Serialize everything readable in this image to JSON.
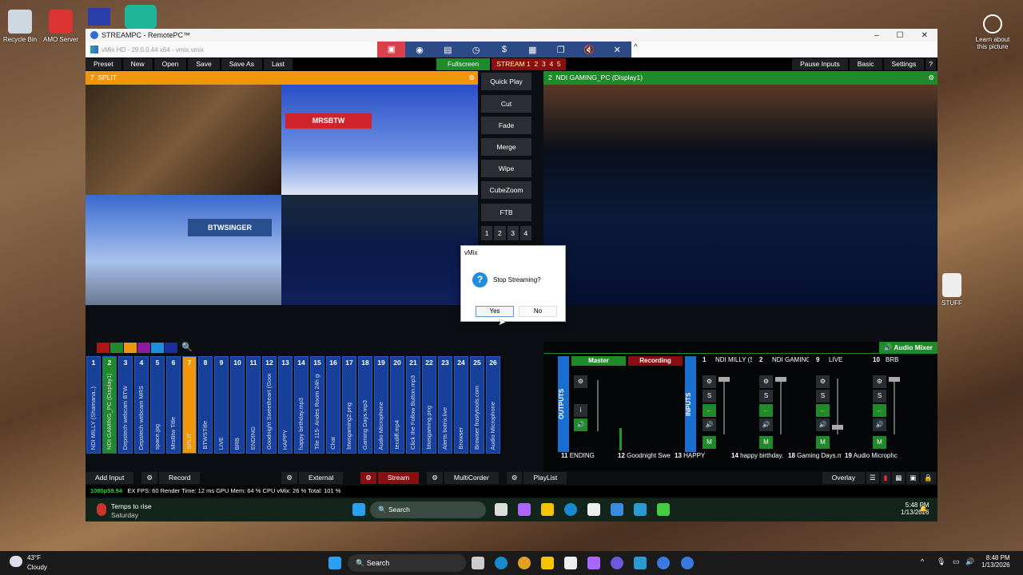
{
  "desktop": {
    "icons": [
      "Recycle Bin",
      "AMO Server"
    ],
    "learn": "Learn about this picture",
    "stuff": "STUFF"
  },
  "remote_window": {
    "title": "STREAMPC - RemotePC™"
  },
  "vmix": {
    "title": "vMix HD - 29.0.0.44 x64 - vmix.vmix",
    "toolbar": {
      "preset": "Preset",
      "new": "New",
      "open": "Open",
      "save": "Save",
      "save_as": "Save As",
      "last": "Last",
      "fullscreen": "Fullscreen",
      "stream": "STREAM",
      "stream_nums": [
        "1",
        "2",
        "3",
        "4",
        "5"
      ],
      "pause_inputs": "Pause Inputs",
      "basic": "Basic",
      "settings": "Settings",
      "help": "?"
    },
    "preview": {
      "number": "7",
      "name": "SPLIT",
      "overlay_labels": [
        "MRSBTW",
        "BTWSINGER"
      ]
    },
    "program": {
      "number": "2",
      "name": "NDI GAMING_PC (Display1)"
    },
    "transitions": [
      "Quick Play",
      "Cut",
      "Fade",
      "Merge",
      "Wipe",
      "CubeZoom",
      "FTB"
    ],
    "transition_nums": [
      "1",
      "2",
      "3",
      "4"
    ],
    "color_tags": [
      "#b01515",
      "#1e8a2a",
      "#f0960a",
      "#8a1aa0",
      "#1a8ee0",
      "#1a2ea0"
    ],
    "inputs": [
      {
        "n": "1",
        "label": "NDI MILLY (Shamana..)"
      },
      {
        "n": "2",
        "label": "NDI GAMING_PC (Display1)",
        "state": "program"
      },
      {
        "n": "3",
        "label": "Depstech webcam BTW"
      },
      {
        "n": "4",
        "label": "Depstech webcam MRS"
      },
      {
        "n": "5",
        "label": "space.jpg"
      },
      {
        "n": "6",
        "label": "MrsBtw Title"
      },
      {
        "n": "7",
        "label": "SPLIT",
        "state": "preview"
      },
      {
        "n": "8",
        "label": "BTWSTitle"
      },
      {
        "n": "9",
        "label": "LIVE"
      },
      {
        "n": "10",
        "label": "BRB"
      },
      {
        "n": "11",
        "label": "ENDING"
      },
      {
        "n": "12",
        "label": "Goodnight Sweetheart (Goodnite"
      },
      {
        "n": "13",
        "label": "HAPPY"
      },
      {
        "n": "14",
        "label": "happy birthday.mp3"
      },
      {
        "n": "15",
        "label": "Tile 115- Andes Room 24h gif"
      },
      {
        "n": "16",
        "label": "Chat"
      },
      {
        "n": "17",
        "label": "btwsgaming2.png"
      },
      {
        "n": "18",
        "label": "Gaming Days.mp3"
      },
      {
        "n": "19",
        "label": "Audio Microphone"
      },
      {
        "n": "20",
        "label": "tecdiff.mp4"
      },
      {
        "n": "21",
        "label": "Click the Follow Button.mp3"
      },
      {
        "n": "22",
        "label": "btwsgaming.png"
      },
      {
        "n": "23",
        "label": "Alerts botrix.live"
      },
      {
        "n": "24",
        "label": "Browser"
      },
      {
        "n": "25",
        "label": "Browser frostytools.com"
      },
      {
        "n": "26",
        "label": "Audio Microphone"
      }
    ],
    "audio_mixer": {
      "title": "Audio Mixer",
      "outputs": "OUTPUTS",
      "inputs_label": "INPUTS",
      "master": "Master",
      "recording": "Recording",
      "channels": [
        {
          "n": "1",
          "name": "NDI MILLY (Sh"
        },
        {
          "n": "2",
          "name": "NDI GAMING_"
        },
        {
          "n": "9",
          "name": "LIVE"
        },
        {
          "n": "10",
          "name": "BRB"
        }
      ],
      "lower": [
        {
          "n": "11",
          "name": "ENDING"
        },
        {
          "n": "12",
          "name": "Goodnight Swe"
        },
        {
          "n": "13",
          "name": "HAPPY"
        },
        {
          "n": "14",
          "name": "happy birthday."
        },
        {
          "n": "18",
          "name": "Gaming Days.m"
        },
        {
          "n": "19",
          "name": "Audio Microphc"
        }
      ],
      "solo": "S",
      "mute": "M",
      "info": "i"
    },
    "bottom": {
      "add_input": "Add Input",
      "record": "Record",
      "external": "External",
      "stream": "Stream",
      "multicorder": "MultiCorder",
      "playlist": "PlayList",
      "overlay": "Overlay"
    },
    "status": {
      "format": "1080p59.94",
      "text": "EX FPS: 60  Render Time: 12 ms  GPU Mem: 64 %  CPU vMix: 26 %  Total: 101 %"
    }
  },
  "remote_taskbar": {
    "weather_title": "Temps to rise",
    "weather_sub": "Saturday",
    "search": "Search",
    "time": "5:48 PM",
    "date": "1/13/2026"
  },
  "dialog": {
    "title": "vMix",
    "message": "Stop Streaming?",
    "yes": "Yes",
    "no": "No"
  },
  "taskbar": {
    "temp": "43°F",
    "weather": "Cloudy",
    "search": "Search",
    "time": "8:48 PM",
    "date": "1/13/2026"
  }
}
